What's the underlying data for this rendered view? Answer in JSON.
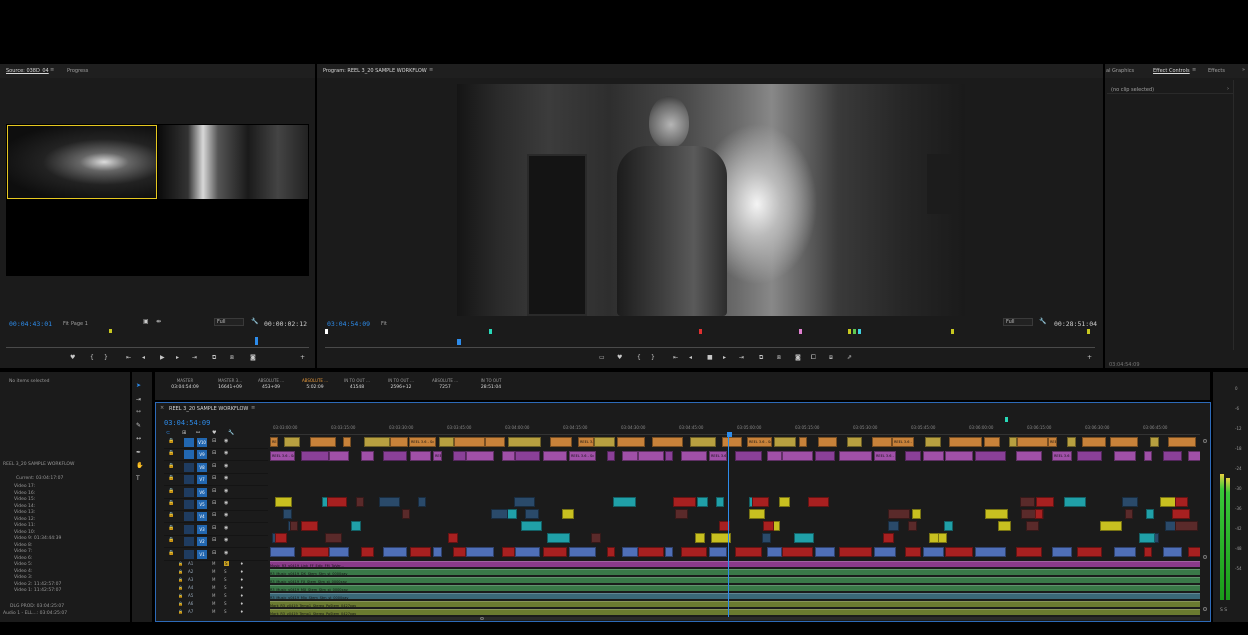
{
  "source_panel": {
    "title": "Source: 038D_04",
    "tab2": "Progress",
    "timecode_left": "00:04:43:01",
    "fit": "Fit",
    "page": "Page 1",
    "zoom": "Full",
    "timecode_right": "00:00:02:12"
  },
  "program_panel": {
    "title": "Program: REEL 3_20 SAMPLE WORKFLOW",
    "timecode_left": "03:04:54:09",
    "fit": "Fit",
    "zoom": "Full",
    "timecode_right": "00:28:51:04"
  },
  "right_panel": {
    "tab1": "al Graphics",
    "tab2": "Effect Controls",
    "tab3": "Effects",
    "more": "»",
    "no_clip": "(no clip selected)",
    "bottom_tc": "03:04:54:09"
  },
  "project_panel": {
    "no_items": "No items selected",
    "seq_name": "REEL 3_20 SAMPLE WORKFLOW",
    "current": "Current: 03:04:17:07",
    "items": [
      "Video 17:",
      "Video 16:",
      "Video 15:",
      "Video 14:",
      "Video 13:",
      "Video 12:",
      "Video 11:",
      "Video 10:",
      "Video 9: 01:34:44:39",
      "Video 8:",
      "Video 7:",
      "Video 6:",
      "Video 5:",
      "Video 4:",
      "Video 3:",
      "Video 2: 11:42:57:07",
      "Video 1: 11:42:57:07"
    ],
    "bottom1": "DLG PROD: 03:04:25:07",
    "bottom2": "Audio 1 - ELL...: 03:04:25:07"
  },
  "metadata_bar": [
    {
      "label": "MASTER",
      "value": "03:04:54:09",
      "active": false
    },
    {
      "label": "MASTER 3...",
      "value": "16641+09",
      "active": false
    },
    {
      "label": "ABSOLUTE ...",
      "value": "453+09",
      "active": false
    },
    {
      "label": "ABSOLUTE ...",
      "value": "5:02:09",
      "active": true
    },
    {
      "label": "IN TO OUT ...",
      "value": "41548",
      "active": false
    },
    {
      "label": "IN TO OUT ...",
      "value": "2596+12",
      "active": false
    },
    {
      "label": "ABSOLUTE ...",
      "value": "7257",
      "active": false
    },
    {
      "label": "IN TO OUT",
      "value": "28:51:04",
      "active": false
    }
  ],
  "timeline": {
    "tab_title": "REEL 3_20 SAMPLE WORKFLOW",
    "timecode": "03:04:54:09",
    "ruler": [
      "03:03:00:00",
      "03:03:15:00",
      "03:03:30:00",
      "03:03:45:00",
      "03:04:00:00",
      "03:04:15:00",
      "03:04:30:00",
      "03:04:45:00",
      "03:05:00:00",
      "03:05:15:00",
      "03:05:30:00",
      "03:05:45:00",
      "03:06:00:00",
      "03:06:15:00",
      "03:06:30:00",
      "03:06:45:00"
    ],
    "video_tracks": [
      "V10",
      "V9",
      "V8",
      "V7",
      "V6",
      "V5",
      "V4",
      "V3",
      "V2",
      "V1"
    ],
    "audio_tracks": [
      "A1",
      "A2",
      "A3",
      "A4",
      "A5",
      "A6",
      "A7"
    ],
    "audio_clip_labels": [
      "Music_R3_v0419_Link_FF_Edlc_FM_ToVer...",
      "R3_Music_v0419_DX_Stem_Stm_st_0000xav",
      "R3_Music_v0419_FX_Stem_Stm_st_0000xav",
      "R3_Music_v0419_MX_Stem_Stm_st_0000xav",
      "R3_Music_v0419_Mix_Stem_Stm_st_0000xav",
      "Mark_R3_v0419_Temp1_Stereo_PoStem_0427xav"
    ],
    "clip_labels_top": [
      "REEL 3.6 - Sc",
      "DL_shoot"
    ]
  },
  "meters": {
    "scale": [
      "0",
      "-6",
      "-12",
      "-18",
      "-24",
      "-30",
      "-36",
      "-42",
      "-48",
      "-54"
    ],
    "footer": "S  S"
  },
  "colors": {
    "accent_blue": "#2d8ceb",
    "v10_orange": "#c8823a",
    "v9_purple": "#a050a8",
    "v1_blue": "#4f6fb8",
    "clip_red": "#a82020",
    "clip_teal": "#20a0a8",
    "clip_yellow": "#c8c020",
    "audio_green": "#3a7848"
  }
}
